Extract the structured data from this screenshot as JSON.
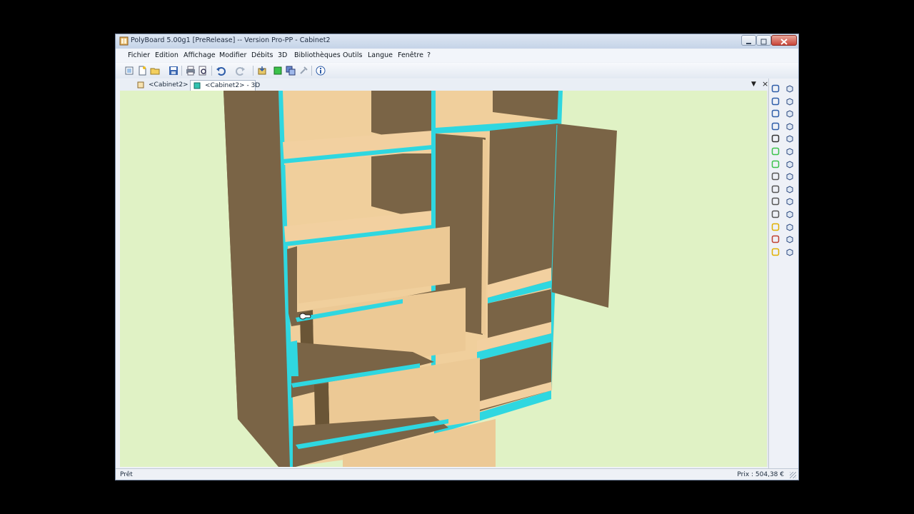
{
  "window": {
    "title": "PolyBoard 5.00g1 [PreRelease] -- Version Pro-PP - Cabinet2"
  },
  "menu": [
    "Fichier",
    "Edition",
    "Affichage",
    "Modifier",
    "Débits",
    "3D",
    "Bibliothèques",
    "Outils",
    "Langue",
    "Fenêtre",
    "?"
  ],
  "toolbar_icons": [
    "new-icon",
    "new-file-icon",
    "open-folder-icon",
    "save-icon",
    "print-icon",
    "print-preview-icon",
    "undo-icon",
    "redo-icon",
    "import-icon",
    "view-3d-icon",
    "view-layers-icon",
    "tools-icon",
    "info-icon"
  ],
  "tabs": [
    {
      "label": "<Cabinet2>",
      "icon": "document-icon"
    },
    {
      "label": "<Cabinet2> - 3D",
      "icon": "cube-icon",
      "active": true
    }
  ],
  "sidebar_left_icons": [
    "orbit-icon",
    "pan-icon",
    "rotate-left-icon",
    "rotate-right-icon",
    "auto-icon",
    "green-box-icon",
    "green-cube-icon",
    "box-outline-icon",
    "box-front-icon",
    "box-plain-icon",
    "box-back-icon",
    "measure-icon",
    "section-icon",
    "cylinder-icon"
  ],
  "sidebar_right_icons": [
    "view-front-icon",
    "view-back-icon",
    "view-left-icon",
    "view-right-icon",
    "view-top-icon",
    "view-bottom-icon",
    "iso-1-icon",
    "iso-2-icon",
    "iso-3-icon",
    "iso-4-icon",
    "iso-5-icon",
    "iso-6-icon",
    "iso-7-icon",
    "iso-8-icon"
  ],
  "status": {
    "left": "Prêt",
    "right": "Prix : 504,38 €"
  },
  "colors": {
    "background": "#e0f2c5",
    "panel_edge": "#2fd7e0",
    "wood_dark": "#7a6446",
    "wood_light": "#f2d0a0",
    "drawer_front": "#ecc995"
  }
}
